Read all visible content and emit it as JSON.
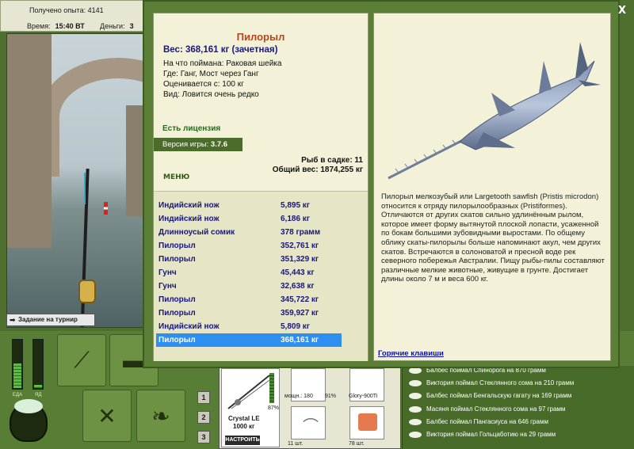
{
  "status": {
    "experience_label": "Получено опыта: 4141",
    "time_label": "Время:",
    "time_value": "15:40 ВТ",
    "money_label": "Деньги:",
    "money_value": "3"
  },
  "scene": {
    "task_label": "Задание на турнир"
  },
  "meters": {
    "food_label": "ЕДА",
    "poison_label": "ЯД"
  },
  "slots": [
    "1",
    "2",
    "3"
  ],
  "gear": {
    "rod_name": "Crystal LE",
    "rod_weight": "1000 кг",
    "setup_label": "НАСТРОИТЬ",
    "rod_percent": "87%",
    "reel_label": "мощн.: 180",
    "reel_percent": "91%",
    "line_label": "Glory-900Ti",
    "hook_count": "11 шт.",
    "bait_count": "78 шт."
  },
  "feed": [
    "Балбес поймал Спинорога на 870 грамм",
    "Виктория поймал Стеклянного сома на 210 грамм",
    "Балбес поймал Бенгальскую гагату на 169 грамм",
    "Масяня поймал Стеклянного сома на 97 грамм",
    "Балбес поймал Пангасиуса на 646 грамм",
    "Виктория поймал Гольцаботию на 29 грамм"
  ],
  "fish": {
    "name": "Пилорыл",
    "weight": "Вес: 368,161 кг (зачетная)",
    "bait": "На что поймана: Раковая шейка",
    "place": "Где: Ганг, Мост через Ганг",
    "price": "Оценивается с: 100 кг",
    "rarity": "Вид: Ловится очень редко",
    "license": "Есть лицензия",
    "version_label": "Версия игры:",
    "version_value": "3.7.6",
    "menu_label": "МЕНЮ",
    "cage_count": "Рыб в садке: 11",
    "total_weight": "Общий вес: 1874,255 кг",
    "description": "Пилорыл мелкозубый или Largetooth sawfish (Pristis microdon) относится к отряду пилорылообразных (Pristiformes). Отличаются от других скатов сильно удлинённым рылом, которое имеет форму вытянутой плоской лопасти, усаженной по бокам большими зубовидными выростами. По общему облику скаты-пилорылы больше напоминают акул, чем других скатов. Встречаются в солоноватой и пресной воде рек северного побережья Австралии. Пищу рыбы-пилы составляют различные мелкие животные, живущие в грунте. Достигает длины около 7 м и веса 600 кг.",
    "hotkeys_label": "Горячие клавиши"
  },
  "catches": [
    {
      "name": "Индийский нож",
      "weight": "5,895 кг"
    },
    {
      "name": "Индийский нож",
      "weight": "6,186 кг"
    },
    {
      "name": "Длинноусый сомик",
      "weight": "378 грамм"
    },
    {
      "name": "Пилорыл",
      "weight": "352,761 кг"
    },
    {
      "name": "Пилорыл",
      "weight": "351,329 кг"
    },
    {
      "name": "Гунч",
      "weight": "45,443 кг"
    },
    {
      "name": "Гунч",
      "weight": "32,638 кг"
    },
    {
      "name": "Пилорыл",
      "weight": "345,722 кг"
    },
    {
      "name": "Пилорыл",
      "weight": "359,927 кг"
    },
    {
      "name": "Индийский нож",
      "weight": "5,809 кг"
    },
    {
      "name": "Пилорыл",
      "weight": "368,161 кг"
    }
  ],
  "selected_catch": 10,
  "close_label": "X",
  "colors": {
    "selected_row": "#2f8ff0",
    "fish_name": "#b4481c",
    "panel": "#f3f1d8",
    "frame": "#5c7f37"
  }
}
